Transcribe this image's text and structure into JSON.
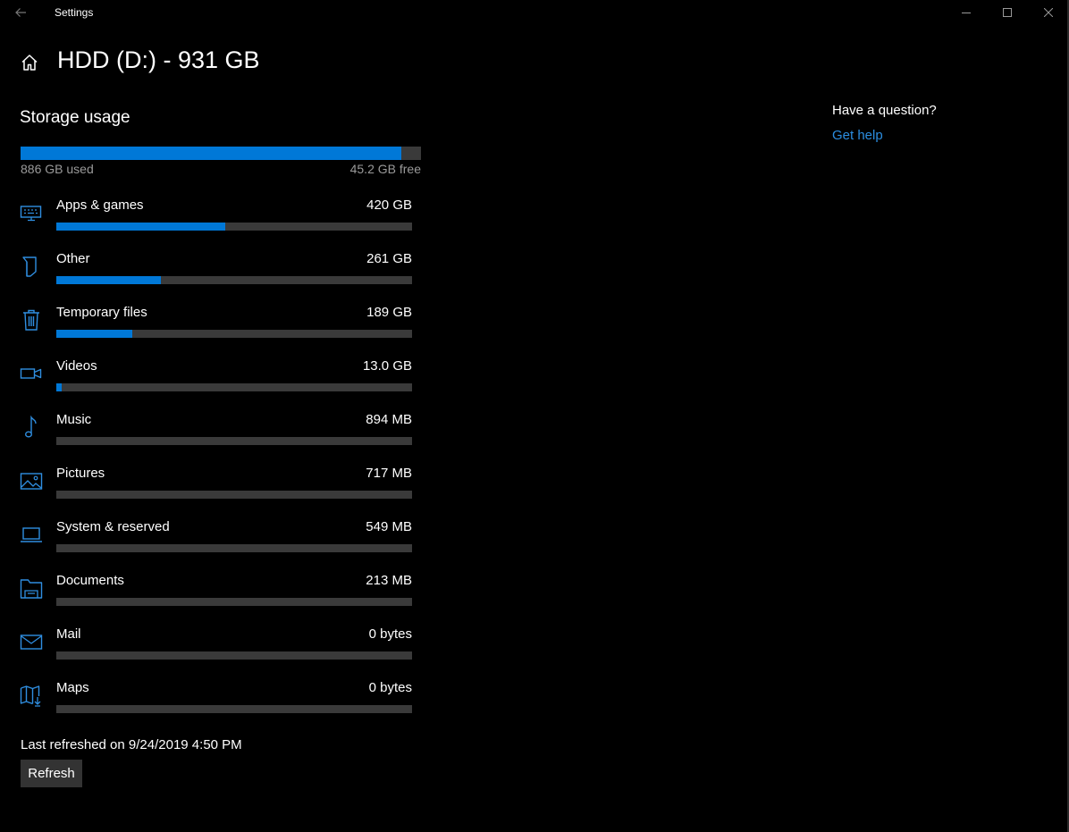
{
  "window": {
    "title": "Settings",
    "controls": {
      "minimize_icon": "minimize-icon",
      "maximize_icon": "maximize-icon",
      "close_icon": "close-icon"
    }
  },
  "header": {
    "home_icon": "home-icon",
    "title": "HDD (D:) - 931 GB"
  },
  "storage": {
    "section_title": "Storage usage",
    "used_label": "886 GB used",
    "free_label": "45.2 GB free",
    "used_fraction": 0.951,
    "accent_color": "#0078d7",
    "track_color": "#3a3a3a",
    "categories": [
      {
        "name": "Apps & games",
        "size": "420 GB",
        "fraction": 0.474,
        "icon": "apps-games-icon"
      },
      {
        "name": "Other",
        "size": "261 GB",
        "fraction": 0.294,
        "icon": "other-icon"
      },
      {
        "name": "Temporary files",
        "size": "189 GB",
        "fraction": 0.213,
        "icon": "trash-icon"
      },
      {
        "name": "Videos",
        "size": "13.0 GB",
        "fraction": 0.015,
        "icon": "video-icon"
      },
      {
        "name": "Music",
        "size": "894 MB",
        "fraction": 0,
        "icon": "music-icon"
      },
      {
        "name": "Pictures",
        "size": "717 MB",
        "fraction": 0,
        "icon": "pictures-icon"
      },
      {
        "name": "System & reserved",
        "size": "549 MB",
        "fraction": 0,
        "icon": "laptop-icon"
      },
      {
        "name": "Documents",
        "size": "213 MB",
        "fraction": 0,
        "icon": "documents-icon"
      },
      {
        "name": "Mail",
        "size": "0 bytes",
        "fraction": 0,
        "icon": "mail-icon"
      },
      {
        "name": "Maps",
        "size": "0 bytes",
        "fraction": 0,
        "icon": "maps-icon"
      }
    ],
    "last_refreshed": "Last refreshed on 9/24/2019 4:50 PM",
    "refresh_label": "Refresh"
  },
  "help": {
    "question": "Have a question?",
    "link": "Get help",
    "link_color": "#2b8de0"
  }
}
